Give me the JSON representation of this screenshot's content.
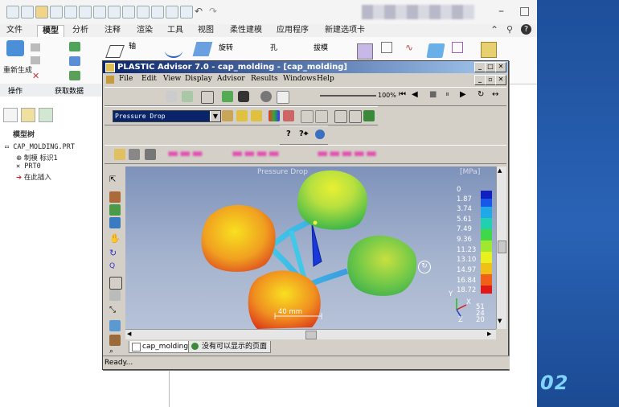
{
  "outer": {
    "tabs": [
      "文件",
      "模型",
      "分析",
      "注释",
      "渲染",
      "工具",
      "视图",
      "柔性建模",
      "应用程序",
      "新建选项卡"
    ],
    "active_tab": "模型",
    "ribbon_labels": {
      "regenerate": "重新生成",
      "axis": "轴",
      "rotate": "旋转",
      "hole": "孔",
      "draft": "拔模"
    },
    "groups": [
      "操作",
      "获取数据"
    ],
    "tree_title": "模型树",
    "tree_items": [
      "CAP_MOLDING.PRT",
      "制模 标识1",
      "PRT0",
      "在此插入"
    ]
  },
  "pa": {
    "title": "PLASTIC Advisor 7.0 - cap_molding - [cap_molding]",
    "menu": [
      "File",
      "Edit",
      "View",
      "Display",
      "Advisor",
      "Results",
      "Windows",
      "Help"
    ],
    "zoom": "100%",
    "result_combo": "Pressure Drop",
    "viewport_title": "Pressure Drop",
    "legend_unit": "[MPa]",
    "legend_values": [
      "0",
      "1.87",
      "3.74",
      "5.61",
      "7.49",
      "9.36",
      "11.23",
      "13.10",
      "14.97",
      "16.84",
      "18.72"
    ],
    "scale_text": "40 mm",
    "axes": {
      "y": "Y",
      "x": "X",
      "z": "Z",
      "v1": "51",
      "v2": "24",
      "v3": "20"
    },
    "bottom_tabs": [
      "cap_molding",
      "没有可以显示的页面"
    ],
    "status": "Ready..."
  },
  "overlay": {
    "number": "02"
  },
  "colors": {
    "title_start": "#0a246a",
    "title_end": "#a6caf0",
    "right_panel": "#1d4f9a",
    "overlay_text": "#7fd4ff"
  }
}
